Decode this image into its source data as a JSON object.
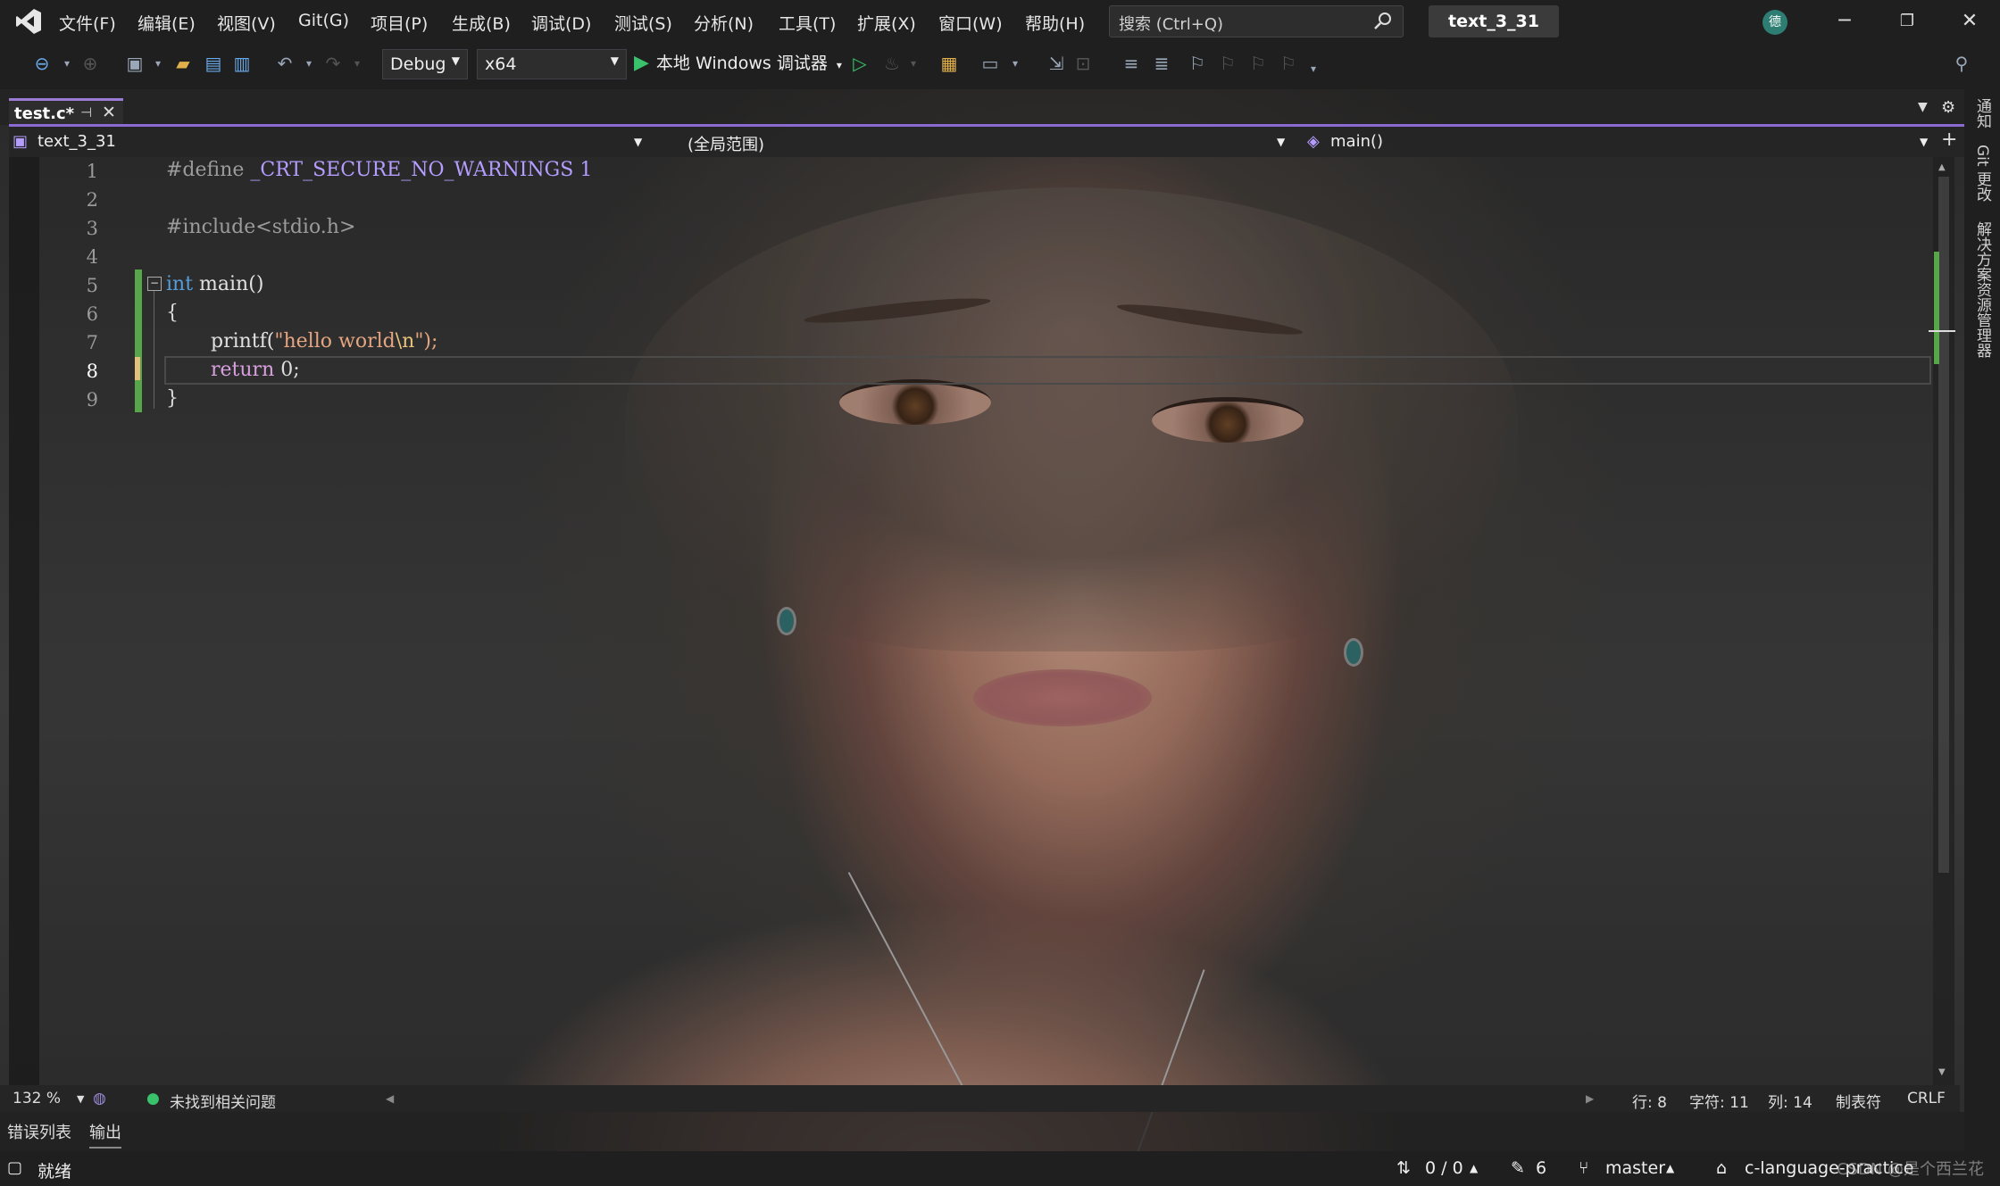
{
  "menu": [
    "文件(F)",
    "编辑(E)",
    "视图(V)",
    "Git(G)",
    "项目(P)",
    "生成(B)",
    "调试(D)",
    "测试(S)",
    "分析(N)",
    "工具(T)",
    "扩展(X)",
    "窗口(W)",
    "帮助(H)"
  ],
  "search": {
    "placeholder": "搜索 (Ctrl+Q)"
  },
  "solution_title": "text_3_31",
  "avatar_initial": "德",
  "toolbar": {
    "config": "Debug",
    "platform": "x64",
    "run_label": "本地 Windows 调试器"
  },
  "tab": {
    "label": "test.c*"
  },
  "navbar": {
    "project": "text_3_31",
    "scope": "(全局范围)",
    "member": "main()"
  },
  "code": {
    "line_numbers": [
      "1",
      "2",
      "3",
      "4",
      "5",
      "6",
      "7",
      "8",
      "9"
    ],
    "l1_pp": "#define",
    "l1_macro": "_CRT_SECURE_NO_WARNINGS",
    "l1_val": "1",
    "l3_pp": "#include<stdio.h>",
    "l5_kw": "int",
    "l5_fn": "main()",
    "l6": "{",
    "l7_fn": "printf(",
    "l7_str": "\"hello world",
    "l7_esc": "\\n",
    "l7_end": "\");",
    "l8_kw": "return",
    "l8_rest": "0;",
    "l9": "}"
  },
  "editor_status": {
    "zoom": "132 %",
    "issues": "未找到相关问题",
    "line": "行: 8",
    "char": "字符: 11",
    "col": "列: 14",
    "tabs": "制表符",
    "eol": "CRLF"
  },
  "bottom_tabs": [
    "错误列表",
    "输出"
  ],
  "statusbar": {
    "ready": "就绪",
    "sync": "0 / 0",
    "edits": "6",
    "branch": "master",
    "repo": "c-language-practice"
  },
  "side_panel": [
    "通知",
    "Git 更改",
    "解决方案资源管理器"
  ],
  "watermark": "CSDN @是个西兰花"
}
